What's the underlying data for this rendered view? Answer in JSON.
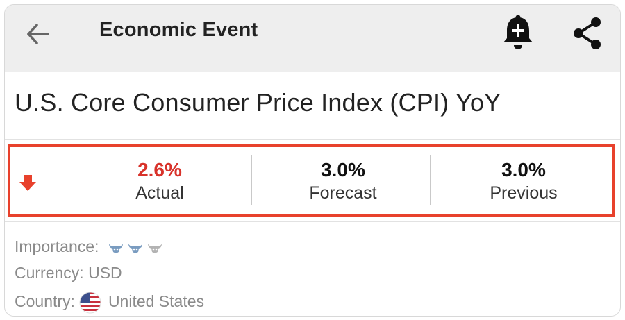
{
  "header": {
    "title": "Economic Event",
    "icons": {
      "back": "back-arrow-icon",
      "alert": "bell-plus-icon",
      "share": "share-icon"
    }
  },
  "event": {
    "title": "U.S. Core Consumer Price Index (CPI) YoY"
  },
  "values": {
    "trend_icon": "down-arrow-icon",
    "actual": {
      "value": "2.6%",
      "label": "Actual"
    },
    "forecast": {
      "value": "3.0%",
      "label": "Forecast"
    },
    "previous": {
      "value": "3.0%",
      "label": "Previous"
    }
  },
  "details": {
    "importance_label": "Importance:",
    "importance_level": 2,
    "importance_max": 3,
    "currency": "Currency: USD",
    "country_label": "Country:",
    "country_name": "United States"
  },
  "colors": {
    "accent_red": "#e8412c",
    "actual_red": "#d8322a",
    "header_bg": "#eeeeee",
    "bull_active": "#7a9cc0",
    "bull_inactive": "#b3b3b3"
  }
}
